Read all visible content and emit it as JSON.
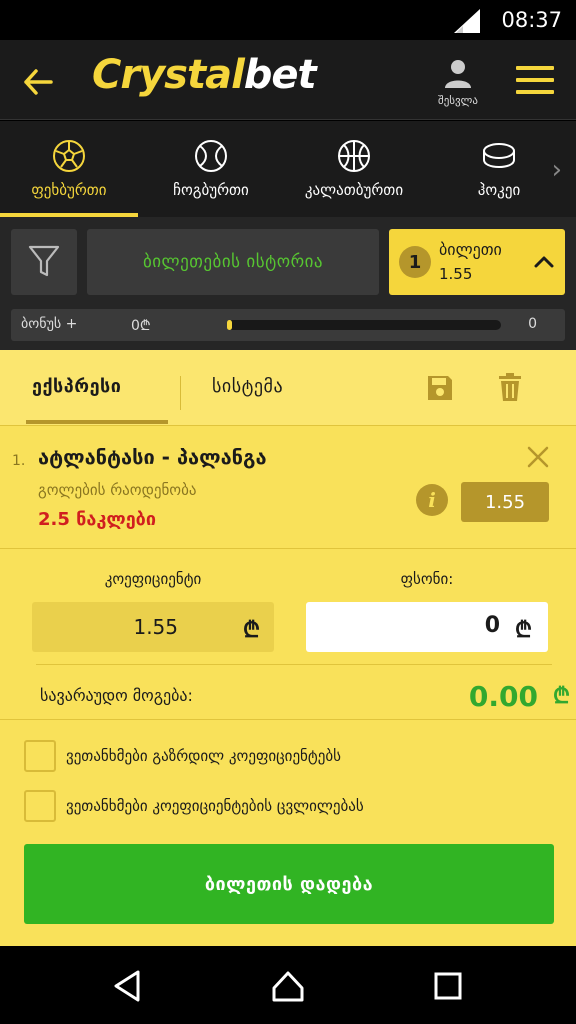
{
  "status_bar": {
    "time": "08:37"
  },
  "header": {
    "logo_part1": "Crystal",
    "logo_part2": "bet",
    "account_label": "შესვლა",
    "accent_color": "#f5d63c"
  },
  "sport_tabs": [
    {
      "label": "ფეხბურთი",
      "icon": "soccer-ball-icon",
      "active": true
    },
    {
      "label": "ჩოგბურთი",
      "icon": "tennis-ball-icon",
      "active": false
    },
    {
      "label": "კალათბურთი",
      "icon": "basketball-icon",
      "active": false
    },
    {
      "label": "ჰოკეი",
      "icon": "hockey-puck-icon",
      "active": false
    }
  ],
  "toolbar": {
    "history_label": "ბილეთების ისტორია",
    "ticket": {
      "count": "1",
      "title": "ბილეთი",
      "odds": "1.55"
    },
    "bonus": {
      "label": "ბონუს +",
      "amount": "0₾",
      "count": "0",
      "progress": 0.02
    }
  },
  "slip": {
    "tabs": [
      {
        "label": "ექსპრესი",
        "active": true
      },
      {
        "label": "სისტემა",
        "active": false
      }
    ],
    "bet": {
      "number": "1.",
      "match": "ატლანტასი - პალანგა",
      "market": "გოლების რაოდენობა",
      "selection": "2.5 ნაკლები",
      "odds": "1.55"
    },
    "coef_label": "კოეფიციენტი",
    "coef_value": "1.55",
    "stake_label": "ფსონი:",
    "stake_value": "0",
    "currency_symbol": "₾",
    "win_label": "სავარაუდო მოგება:",
    "win_value": "0.00",
    "checkboxes": [
      {
        "label": "ვეთანხმები გაზრდილ კოეფიციენტებს"
      },
      {
        "label": "ვეთანხმები კოეფიციენტების ცვლილებას"
      }
    ],
    "place_label": "ბილეთის დადება"
  }
}
